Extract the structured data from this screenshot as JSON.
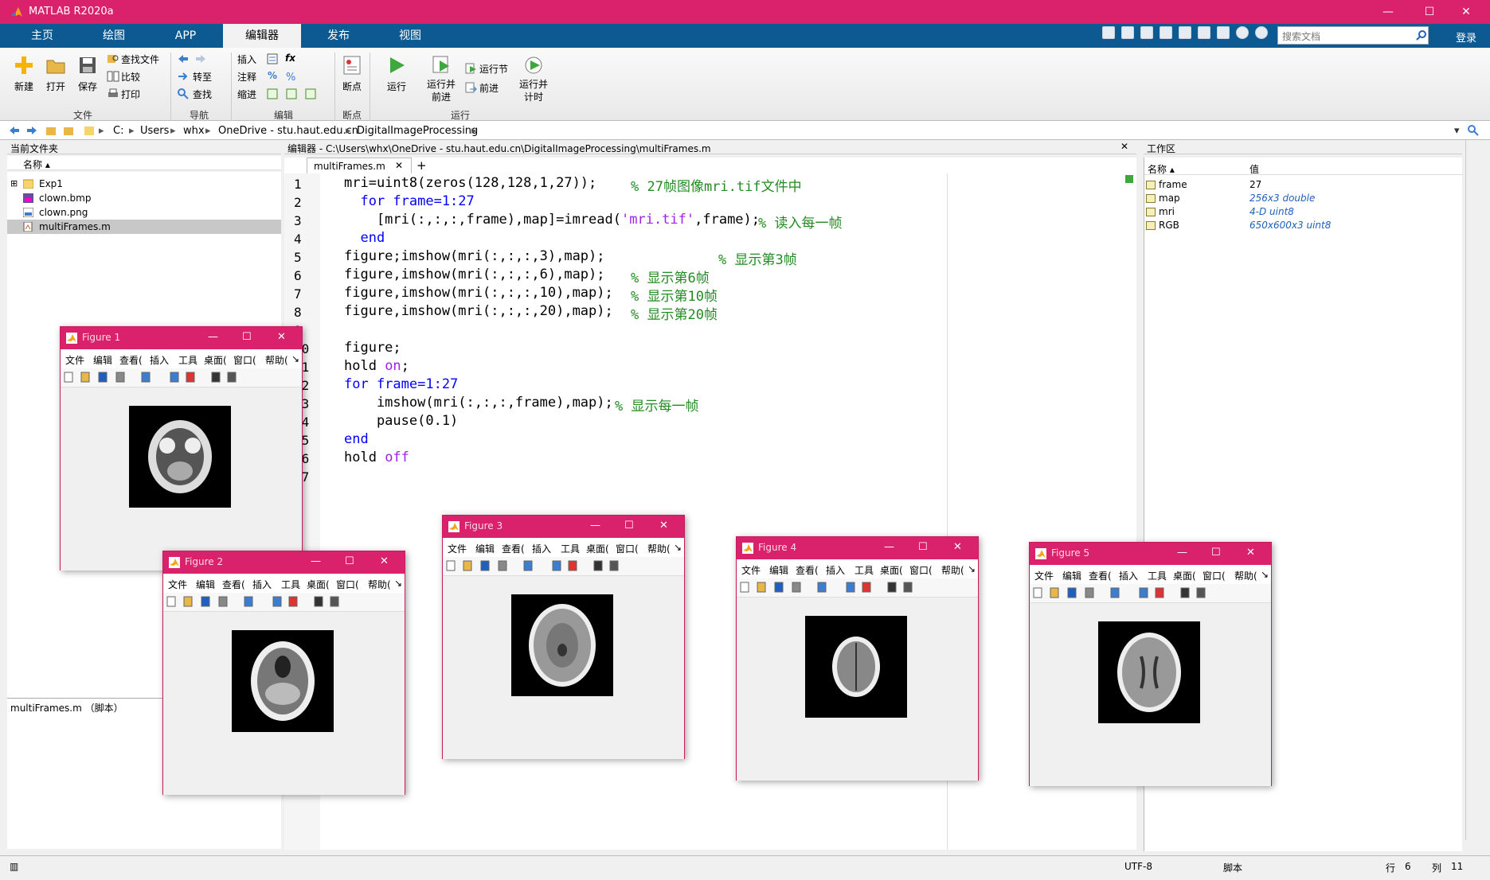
{
  "window": {
    "title": "MATLAB R2020a",
    "min": "—",
    "max": "☐",
    "close": "✕"
  },
  "tabs": [
    {
      "label": "主页",
      "active": false
    },
    {
      "label": "绘图",
      "active": false
    },
    {
      "label": "APP",
      "active": false
    },
    {
      "label": "编辑器",
      "active": true
    },
    {
      "label": "发布",
      "active": false
    },
    {
      "label": "视图",
      "active": false
    }
  ],
  "search": {
    "placeholder": "搜索文档"
  },
  "login": "登录",
  "ribbon": {
    "file": {
      "new": "新建",
      "open": "打开",
      "save": "保存",
      "find_files": "查找文件",
      "compare": "比较",
      "print": "打印",
      "group": "文件"
    },
    "nav": {
      "goto": "转至",
      "find": "查找",
      "group": "导航"
    },
    "edit": {
      "insert": "插入",
      "comment": "注释",
      "indent": "缩进",
      "fx": "fx",
      "pct": "%",
      "group": "编辑"
    },
    "breakpoints": {
      "label": "断点",
      "group": "断点"
    },
    "run": {
      "run": "运行",
      "run_advance": "运行并\n前进",
      "run_section": "运行节",
      "advance": "前进",
      "run_time": "运行并\n计时",
      "group": "运行"
    }
  },
  "address": {
    "parts": [
      "C:",
      "Users",
      "whx",
      "OneDrive - stu.haut.edu.cn",
      "DigitalImageProcessing"
    ]
  },
  "current_folder": {
    "title": "当前文件夹",
    "col_name": "名称 ▴",
    "items": [
      {
        "name": "Exp1",
        "type": "folder",
        "selected": false
      },
      {
        "name": "clown.bmp",
        "type": "bmp",
        "selected": false
      },
      {
        "name": "clown.png",
        "type": "png",
        "selected": false
      },
      {
        "name": "multiFrames.m",
        "type": "m",
        "selected": true
      }
    ],
    "detail": "multiFrames.m （脚本）"
  },
  "editor": {
    "header": "编辑器 - C:\\Users\\whx\\OneDrive - stu.haut.edu.cn\\DigitalImageProcessing\\multiFrames.m",
    "tab": "multiFrames.m",
    "add_tab": "+",
    "line_numbers": [
      "1",
      "2",
      "3",
      "4",
      "5",
      "6",
      "7",
      "8",
      "9",
      "10",
      "11",
      "12",
      "13",
      "14",
      "15",
      "16",
      "17"
    ],
    "lines": [
      "mri=uint8(zeros(128,128,1,27));",
      "  for frame=1:27",
      "    [mri(:,:,:,frame),map]=imread('mri.tif',frame);",
      "  end",
      "figure;imshow(mri(:,:,:,3),map);",
      "figure,imshow(mri(:,:,:,6),map);",
      "figure,imshow(mri(:,:,:,10),map);",
      "figure,imshow(mri(:,:,:,20),map);",
      "",
      "figure;",
      "hold on;",
      "for frame=1:27",
      "    imshow(mri(:,:,:,frame),map);",
      "    pause(0.1)",
      "end",
      "hold off",
      ""
    ],
    "comments": {
      "0": "% 27帧图像mri.tif文件中",
      "2": "% 读入每一帧",
      "4": "% 显示第3帧",
      "5": "% 显示第6帧",
      "6": "% 显示第10帧",
      "7": "% 显示第20帧",
      "12": "% 显示每一帧"
    }
  },
  "workspace": {
    "title": "工作区",
    "col_name": "名称 ▴",
    "col_value": "值",
    "vars": [
      {
        "name": "frame",
        "value": "27",
        "italic": false
      },
      {
        "name": "map",
        "value": "256x3 double",
        "italic": true
      },
      {
        "name": "mri",
        "value": "4-D uint8",
        "italic": true
      },
      {
        "name": "RGB",
        "value": "650x600x3 uint8",
        "italic": true
      }
    ]
  },
  "status": {
    "encoding": "UTF-8",
    "type": "脚本",
    "row_label": "行",
    "row": "6",
    "col_label": "列",
    "col": "11"
  },
  "figures": [
    {
      "title": "Figure 1",
      "slice": "3"
    },
    {
      "title": "Figure 2",
      "slice": "6"
    },
    {
      "title": "Figure 3",
      "slice": "10"
    },
    {
      "title": "Figure 4",
      "slice": "20"
    },
    {
      "title": "Figure 5",
      "slice": "27"
    }
  ],
  "figure_menu": [
    "文件",
    "编辑",
    "查看(",
    "插入",
    "工具",
    "桌面(",
    "窗口(",
    "帮助(",
    "↘"
  ],
  "colors": {
    "titlebar": "#d9226b",
    "ribbon_tabs": "#0c5a91",
    "keyword": "#0000ff",
    "string": "#a020f0",
    "comment": "#228b22"
  }
}
